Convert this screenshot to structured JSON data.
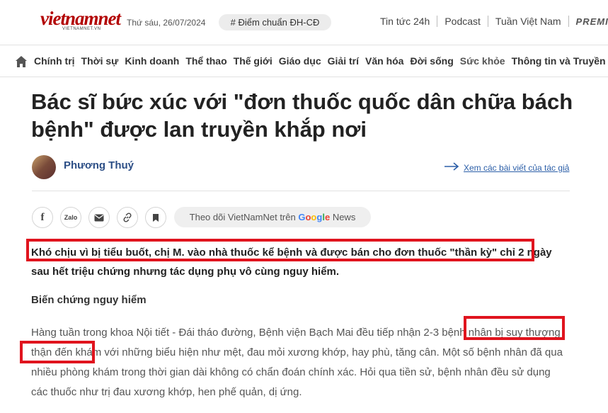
{
  "header": {
    "logo_text": "vietnamnet",
    "logo_sub": "VIETNAMNET.VN",
    "date": "Thứ sáu, 26/07/2024",
    "tag": "# Điểm chuẩn ĐH-CĐ",
    "links": [
      "Tin tức 24h",
      "Podcast",
      "Tuần Việt Nam"
    ],
    "premium": "PREMIUM"
  },
  "nav": {
    "home_icon": "home-icon",
    "items": [
      "Chính trị",
      "Thời sự",
      "Kinh doanh",
      "Thể thao",
      "Thế giới",
      "Giáo dục",
      "Giải trí",
      "Văn hóa",
      "Đời sống",
      "Sức khỏe",
      "Thông tin và Truyền thông"
    ],
    "active": "Sức khỏe"
  },
  "article": {
    "title": "Bác sĩ bức xúc với \"đơn thuốc quốc dân chữa bách bệnh\" được lan truyền khắp nơi",
    "author": "Phương Thuý",
    "more_by_author": "Xem các bài viết của tác giả",
    "share": {
      "facebook": "f",
      "zalo": "Zalo",
      "follow_prefix": "Theo dõi VietNamNet trên",
      "google": [
        "G",
        "o",
        "o",
        "g",
        "l",
        "e"
      ],
      "news": "News"
    },
    "lead": "Khó chịu vì bị tiểu buốt, chị M. vào nhà thuốc kể bệnh và được bán cho đơn thuốc \"thần kỳ\" chỉ 2 ngày sau hết triệu chứng nhưng tác dụng phụ vô cùng nguy hiểm.",
    "subheading": "Biến chứng nguy hiểm",
    "paragraph": "Hàng tuần trong khoa Nội tiết - Đái tháo đường, Bệnh viện Bạch Mai đều tiếp nhận 2-3 bệnh nhân bị suy thượng thận đến khám với những biểu hiện như mệt, đau mỏi xương khớp, hay phù, tăng cân. Một số bệnh nhân đã qua nhiều phòng khám trong thời gian dài không có chẩn đoán chính xác. Hỏi qua tiền sử, bệnh nhân đều sử dụng các thuốc như trị đau xương khớp, hen phế quản, dị ứng."
  },
  "colors": {
    "highlight": "#e0141e",
    "author": "#2c4e86",
    "logo": "#b20000"
  }
}
